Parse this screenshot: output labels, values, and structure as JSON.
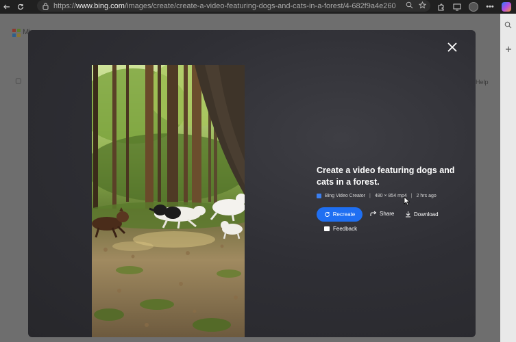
{
  "browser": {
    "url_prefix": "https://",
    "url_host": "www.bing.com",
    "url_path": "/images/create/create-a-video-featuring-dogs-and-cats-in-a-forest/4-682f9a4e26054d6ab31b...",
    "icons": [
      "back-icon",
      "refresh-icon",
      "lock-icon",
      "search-icon",
      "star-icon",
      "extensions-icon",
      "screenshot-icon",
      "profile-icon",
      "more-icon",
      "copilot-icon"
    ]
  },
  "page": {
    "brand_text": "Mi",
    "help_text": "Help"
  },
  "modal": {
    "close_icon": "close-icon",
    "title": "Create a video featuring dogs and cats in a forest.",
    "source_label": "Bing Video Creator",
    "separator": "|",
    "resolution": "480 × 854 mp4",
    "age": "2 hrs ago",
    "actions": {
      "recreate": "Recreate",
      "share": "Share",
      "download": "Download",
      "feedback": "Feedback"
    }
  },
  "colors": {
    "accent": "#1f6ff2",
    "modal_bg": "#2e2e33",
    "overlay": "#6e6e6e"
  }
}
